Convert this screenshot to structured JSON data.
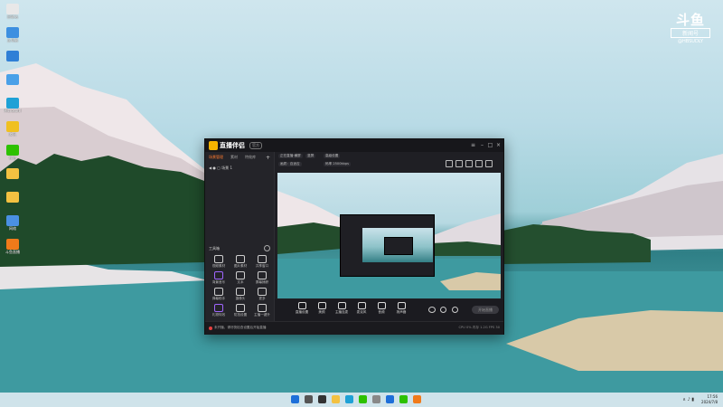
{
  "watermark": {
    "logo": "斗鱼",
    "sub": "新闻号",
    "id": "@HBSUDLY"
  },
  "desktop": {
    "icons": [
      {
        "name": "recycle-bin",
        "label": "回收站",
        "color": "#e8e8e8"
      },
      {
        "name": "this-pc",
        "label": "此电脑",
        "color": "#3d8fe0"
      },
      {
        "name": "control-panel",
        "label": "",
        "color": "#2f7fd6"
      },
      {
        "name": "app-blue",
        "label": "",
        "color": "#4aa0e8"
      },
      {
        "name": "edge",
        "label": "Microsoft Edge",
        "color": "#1fa1d6"
      },
      {
        "name": "tencent-app",
        "label": "腾讯",
        "color": "#f0c020"
      },
      {
        "name": "wechat",
        "label": "微信",
        "color": "#2dc100"
      },
      {
        "name": "folder-1",
        "label": "",
        "color": "#f3c141"
      },
      {
        "name": "folder-2",
        "label": "",
        "color": "#f3c141"
      },
      {
        "name": "network",
        "label": "网络",
        "color": "#4a90e2"
      },
      {
        "name": "douyu-live",
        "label": "斗鱼直播",
        "color": "#f07a1a"
      }
    ]
  },
  "app": {
    "title": "直播伴侣",
    "version": "官方",
    "controls": {
      "menu": "≡",
      "minimize": "–",
      "maximize": "□",
      "close": "×"
    },
    "left_panel": {
      "tabs": [
        "场景管理",
        "素材",
        "特效库"
      ],
      "add": "+",
      "scene": "场景 1",
      "tools_title": "工具箱",
      "tools": [
        {
          "name": "video-source",
          "label": "视频素材",
          "color": "#cfcfcf"
        },
        {
          "name": "image-source",
          "label": "图片素材",
          "color": "#cfcfcf"
        },
        {
          "name": "screen-share",
          "label": "共享窗口",
          "color": "#cfcfcf"
        },
        {
          "name": "music",
          "label": "背景音乐",
          "color": "#a066ff"
        },
        {
          "name": "text",
          "label": "文本",
          "color": "#cfcfcf"
        },
        {
          "name": "capture",
          "label": "屏幕捕获",
          "color": "#cfcfcf"
        },
        {
          "name": "effects",
          "label": "弹幕助手",
          "color": "#cfcfcf"
        },
        {
          "name": "camera",
          "label": "摄像头",
          "color": "#cfcfcf"
        },
        {
          "name": "more",
          "label": "更多",
          "color": "#cfcfcf"
        },
        {
          "name": "gift",
          "label": "礼物特效",
          "color": "#a066ff"
        },
        {
          "name": "shield",
          "label": "防挡设置",
          "color": "#cfcfcf"
        },
        {
          "name": "upgrade",
          "label": "主播一键升",
          "color": "#cfcfcf"
        }
      ]
    },
    "right_top": {
      "tags": [
        "正在直播·横屏",
        "竖屏",
        "高级设置",
        "画质：自适应"
      ],
      "stats": "码率 2500kbps"
    },
    "bottom_bar": {
      "items": [
        {
          "name": "live-settings",
          "label": "直播设置"
        },
        {
          "name": "beauty",
          "label": "美颜"
        },
        {
          "name": "pk",
          "label": "主播连麦"
        },
        {
          "name": "mic",
          "label": "麦克风"
        },
        {
          "name": "speaker",
          "label": "音频"
        },
        {
          "name": "volume",
          "label": "扬声器"
        }
      ],
      "go_live": "开始直播"
    },
    "status_bar": {
      "text": "未开播，请尽快检查设置后开始直播",
      "right": "CPU 0%  内存 1.2G  FPS 30"
    }
  },
  "taskbar": {
    "icons": [
      {
        "name": "start",
        "color": "#1e6fd9"
      },
      {
        "name": "search",
        "color": "#555"
      },
      {
        "name": "task-view",
        "color": "#333"
      },
      {
        "name": "file-explorer",
        "color": "#f3c141"
      },
      {
        "name": "edge-task",
        "color": "#1fa1d6"
      },
      {
        "name": "xbox",
        "color": "#2dc100"
      },
      {
        "name": "settings",
        "color": "#888"
      },
      {
        "name": "qq",
        "color": "#1e6fd9"
      },
      {
        "name": "app-green",
        "color": "#2dc100"
      },
      {
        "name": "douyu",
        "color": "#f07a1a"
      }
    ],
    "tray": "∧  ♪  ▮",
    "time": "17:56",
    "date": "2024/7/8"
  }
}
